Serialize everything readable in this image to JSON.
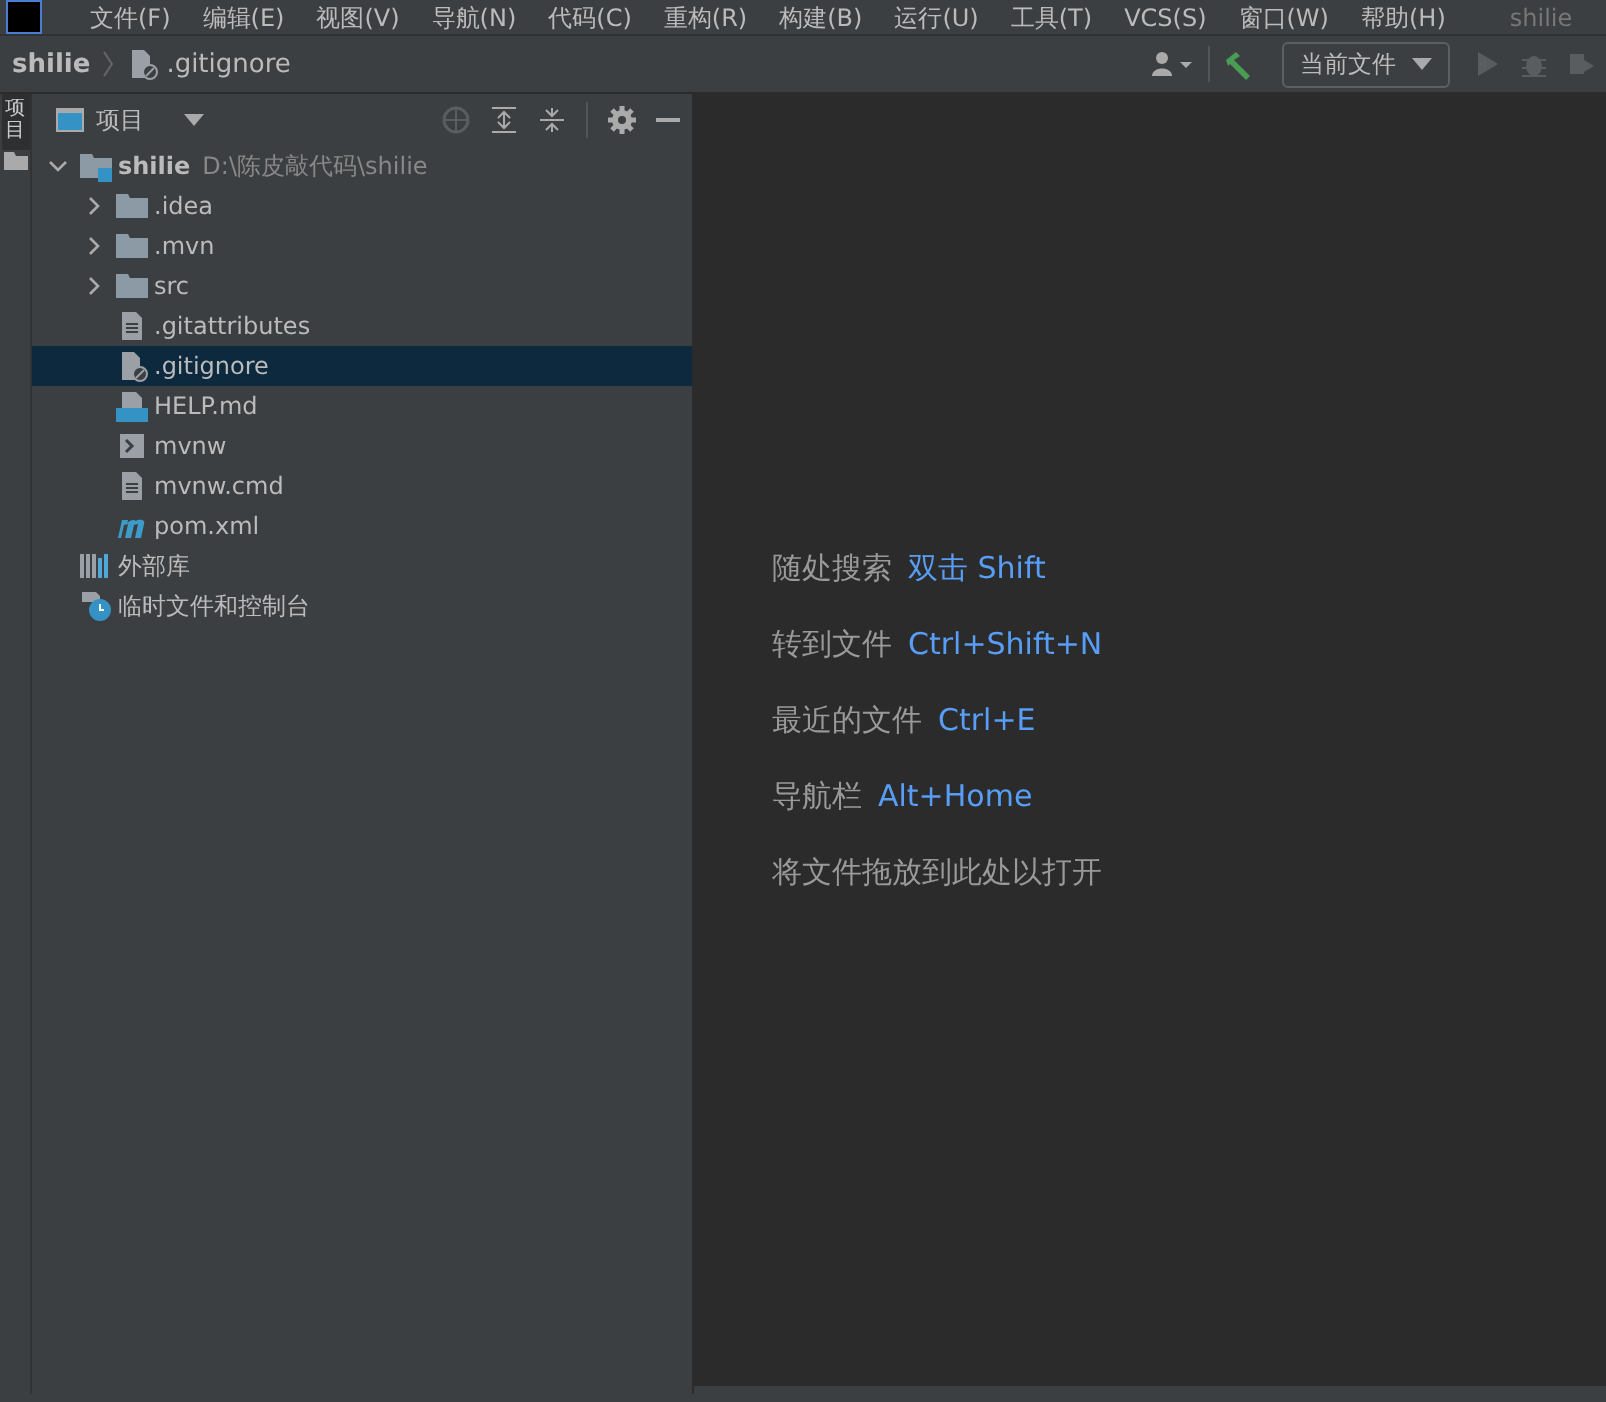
{
  "menu_bar": {
    "items": [
      "文件(F)",
      "编辑(E)",
      "视图(V)",
      "导航(N)",
      "代码(C)",
      "重构(R)",
      "构建(B)",
      "运行(U)",
      "工具(T)",
      "VCS(S)",
      "窗口(W)",
      "帮助(H)"
    ],
    "title": "shilie"
  },
  "breadcrumb": {
    "project": "shilie",
    "file": ".gitignore"
  },
  "toolbar": {
    "run_config": "当前文件"
  },
  "side_stripe": {
    "label": "项目"
  },
  "project_panel": {
    "view": "项目",
    "tree": [
      {
        "kind": "module",
        "label": "shilie",
        "path": "D:\\陈皮敲代码\\shilie",
        "expanded": true,
        "selected": false,
        "children": [
          {
            "kind": "folder",
            "label": ".idea",
            "expanded": false,
            "selected": false
          },
          {
            "kind": "folder",
            "label": ".mvn",
            "expanded": false,
            "selected": false
          },
          {
            "kind": "folder",
            "label": "src",
            "expanded": false,
            "selected": false
          },
          {
            "kind": "text",
            "label": ".gitattributes",
            "selected": false
          },
          {
            "kind": "ignore",
            "label": ".gitignore",
            "selected": true
          },
          {
            "kind": "markdown",
            "label": "HELP.md",
            "selected": false
          },
          {
            "kind": "shell",
            "label": "mvnw",
            "selected": false
          },
          {
            "kind": "text",
            "label": "mvnw.cmd",
            "selected": false
          },
          {
            "kind": "maven",
            "label": "pom.xml",
            "selected": false
          }
        ]
      },
      {
        "kind": "libraries",
        "label": "外部库",
        "selected": false
      },
      {
        "kind": "scratches",
        "label": "临时文件和控制台",
        "selected": false
      }
    ]
  },
  "editor": {
    "hints": [
      {
        "text": "随处搜索",
        "shortcut": "双击 Shift"
      },
      {
        "text": "转到文件",
        "shortcut": "Ctrl+Shift+N"
      },
      {
        "text": "最近的文件",
        "shortcut": "Ctrl+E"
      },
      {
        "text": "导航栏",
        "shortcut": "Alt+Home"
      },
      {
        "text": "将文件拖放到此处以打开"
      }
    ]
  }
}
